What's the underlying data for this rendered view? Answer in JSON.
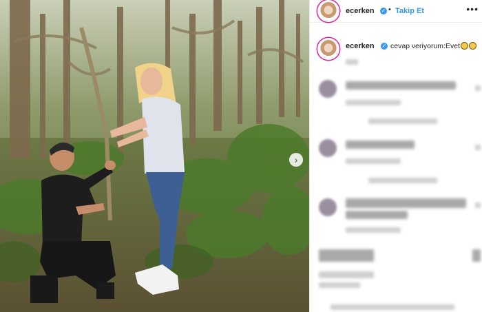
{
  "header": {
    "username": "ecerken",
    "follow_label": "Takip Et",
    "separator": "•",
    "more_label": "•••"
  },
  "caption": {
    "username": "ecerken",
    "text": "cevap veriyorum:Evet"
  },
  "post": {
    "next_label": "›"
  },
  "colors": {
    "follow_blue": "#3897f0",
    "verified_blue": "#3897f0",
    "story_ring": "#d6249f"
  }
}
